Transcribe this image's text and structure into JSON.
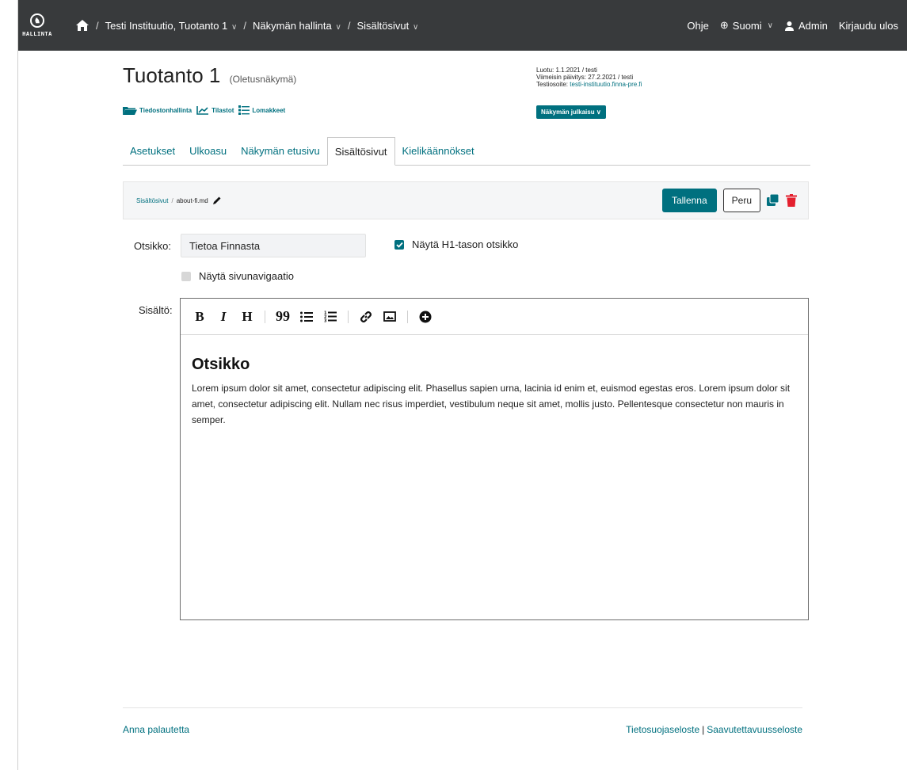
{
  "topbar": {
    "logo_text": "HALLINTA",
    "breadcrumbs": [
      {
        "label": "Testi Instituutio, Tuotanto 1"
      },
      {
        "label": "Näkymän hallinta"
      },
      {
        "label": "Sisältösivut"
      }
    ],
    "help": "Ohje",
    "language": "Suomi",
    "user": "Admin",
    "logout": "Kirjaudu ulos"
  },
  "header": {
    "title": "Tuotanto 1",
    "subtitle": "(Oletusnäkymä)",
    "created": "Luotu: 1.1.2021 / testi",
    "updated": "Viimeisin päivitys: 27.2.2021 / testi",
    "test_address_label": "Testiosoite:",
    "test_address": "testi-instituutio.finna-pre.fi",
    "tools": {
      "files": "Tiedostonhallinta",
      "stats": "Tilastot",
      "forms": "Lomakkeet"
    },
    "publish_button": "Näkymän julkaisu"
  },
  "tabs": [
    {
      "label": "Asetukset"
    },
    {
      "label": "Ulkoasu"
    },
    {
      "label": "Näkymän etusivu"
    },
    {
      "label": "Sisältösivut",
      "active": true
    },
    {
      "label": "Kielikäännökset"
    }
  ],
  "pagebar": {
    "crumb": "Sisältösivut",
    "file": "about-fi.md",
    "save": "Tallenna",
    "cancel": "Peru"
  },
  "form": {
    "title_label": "Otsikko:",
    "title_value": "Tietoa Finnasta",
    "show_h1_label": "Näytä H1-tason otsikko",
    "show_h1_checked": true,
    "show_nav_label": "Näytä sivunavigaatio",
    "show_nav_checked": false,
    "content_label": "Sisältö:"
  },
  "editor": {
    "toolbar": {
      "bold": "B",
      "italic": "I",
      "heading": "H",
      "quote": "99"
    },
    "heading": "Otsikko",
    "body": "Lorem ipsum dolor sit amet, consectetur adipiscing elit. Phasellus sapien urna, lacinia id enim et, euismod egestas eros. Lorem ipsum dolor sit amet, consectetur adipiscing elit. Nullam nec risus imperdiet, vestibulum neque sit amet, mollis justo. Pellentesque consectetur non mauris in semper."
  },
  "footer": {
    "feedback": "Anna palautetta",
    "privacy": "Tietosuojaseloste",
    "accessibility": "Saavutettavuusseloste"
  },
  "colors": {
    "accent": "#00707f",
    "topbar": "#383a3c",
    "danger": "#e4202e"
  }
}
